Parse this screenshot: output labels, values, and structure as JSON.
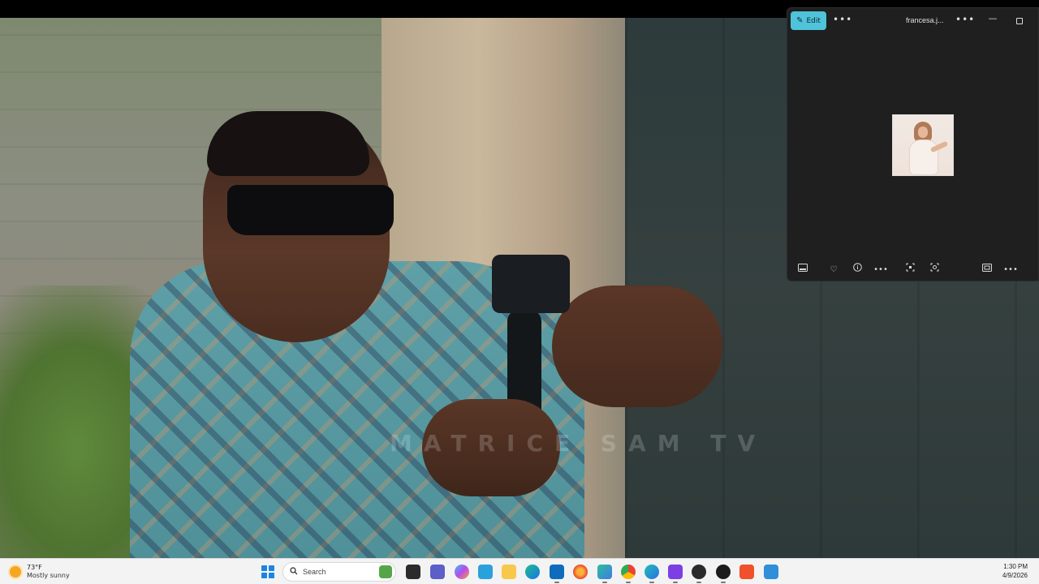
{
  "video": {
    "watermark": "MATRICE SAM TV"
  },
  "photos_window": {
    "edit_label": "Edit",
    "title": "francesa.j...",
    "toolbar_icons": [
      "filmstrip-icon",
      "heart-icon",
      "info-icon",
      "more-icon",
      "fit-to-window-icon",
      "visual-search-icon",
      "fullscreen-icon",
      "more-icon"
    ]
  },
  "taskbar": {
    "weather": {
      "temp": "73°F",
      "condition": "Mostly sunny"
    },
    "search_placeholder": "Search",
    "apps": [
      "terminal",
      "teams",
      "copilot",
      "store",
      "file-explorer",
      "edge",
      "calendar",
      "firefox",
      "photos",
      "chrome",
      "edge-dev",
      "app-purple",
      "app-dark",
      "media-player",
      "brave",
      "app-blue"
    ],
    "clock": {
      "time": "1:30 PM",
      "date": "4/9/2026"
    }
  }
}
